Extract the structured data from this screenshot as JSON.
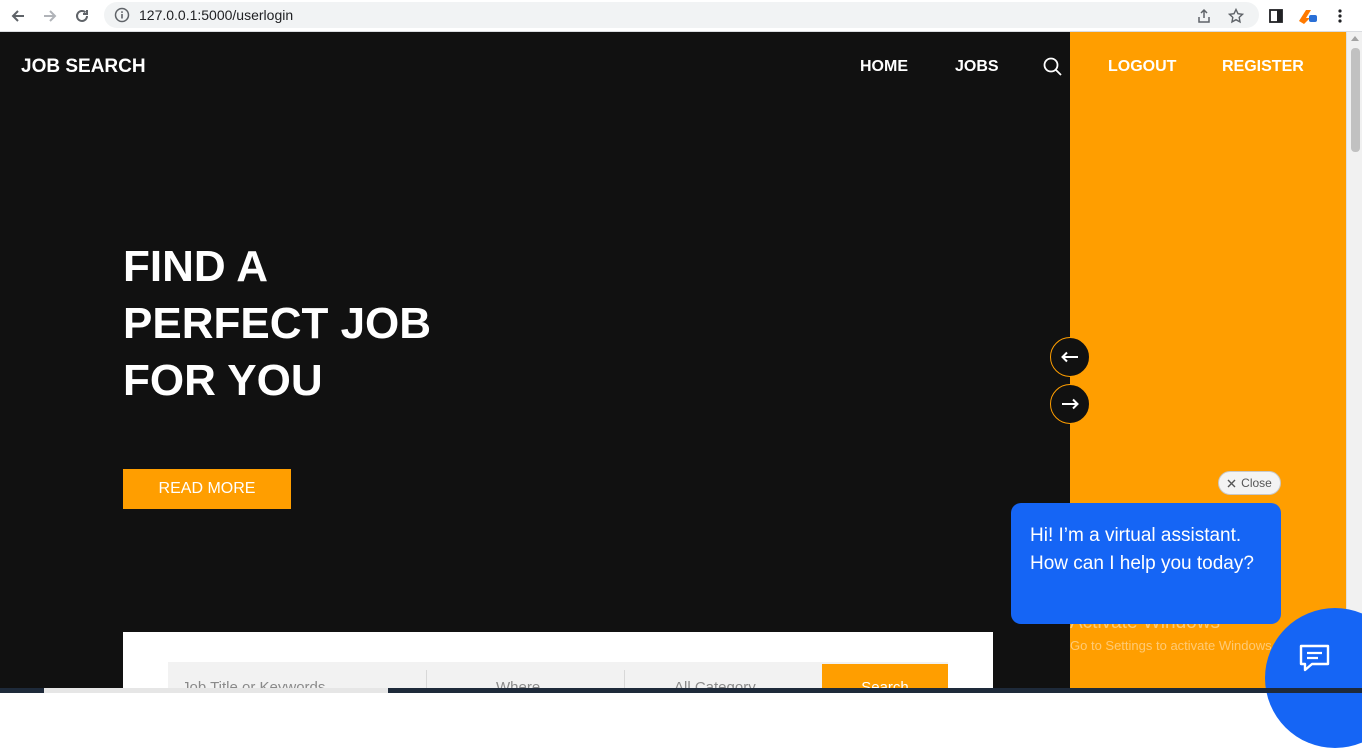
{
  "browser": {
    "url": "127.0.0.1:5000/userlogin"
  },
  "header": {
    "brand": "JOB SEARCH",
    "nav": {
      "home": "HOME",
      "jobs": "JOBS",
      "logout": "LOGOUT",
      "register": "REGISTER"
    }
  },
  "hero": {
    "title_line1": "FIND A",
    "title_line2": "PERFECT JOB",
    "title_line3": "FOR YOU",
    "read_more": "READ MORE"
  },
  "search": {
    "keyword_placeholder": "Job Title or Keywords",
    "where_placeholder": "Where",
    "category_placeholder": "All Category",
    "submit_label": "Search"
  },
  "chat": {
    "close_label": "Close",
    "message": "Hi! I’m a virtual assistant. How can I help you today?"
  },
  "watermark": {
    "line1": "Activate Windows",
    "line2": "Go to Settings to activate Windows."
  },
  "colors": {
    "accent": "#ff9e00",
    "page_background": "#111111",
    "chat_blue": "#1565f5"
  }
}
